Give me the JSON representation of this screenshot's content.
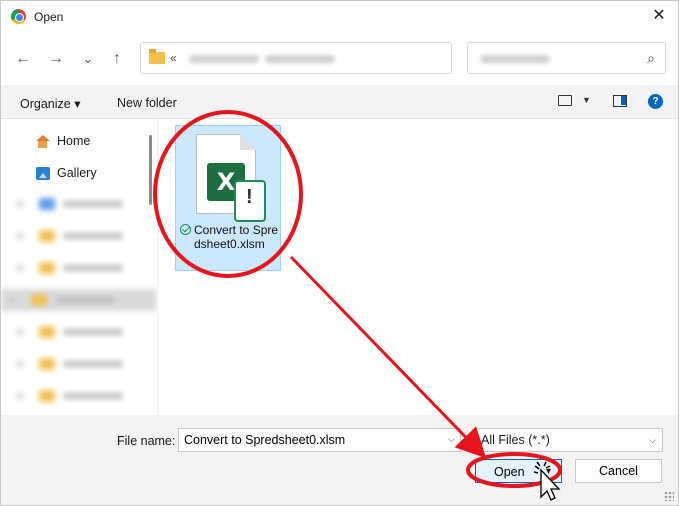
{
  "window": {
    "title": "Open",
    "close_glyph": "✕"
  },
  "nav": {
    "back_glyph": "←",
    "forward_glyph": "→",
    "history_glyph": "⌄",
    "up_glyph": "↑",
    "address_prefix": "«",
    "search_glyph": "⌕"
  },
  "toolbar": {
    "organize_label": "Organize ▾",
    "new_folder_label": "New folder",
    "view_chev": "▼",
    "help_glyph": "?"
  },
  "sidebar": {
    "items": [
      {
        "label": "Home",
        "icon": "home-icon"
      },
      {
        "label": "Gallery",
        "icon": "gallery-icon"
      }
    ]
  },
  "files": [
    {
      "name": "Convert to Spredsheet0.xlsm",
      "icon": "excel-icon",
      "badge": "X",
      "status": "synced",
      "selected": true
    }
  ],
  "footer": {
    "file_name_label": "File name:",
    "file_name_value": "Convert to Spredsheet0.xlsm",
    "dropdown_glyph": "⌵",
    "file_type": "All Files (*.*)",
    "open_label": "Open",
    "split_glyph": "▾",
    "cancel_label": "Cancel"
  },
  "colors": {
    "accent": "#0067c0",
    "selection": "#cce8ff",
    "annotation": "#e8141b",
    "excel": "#1d6f42"
  }
}
